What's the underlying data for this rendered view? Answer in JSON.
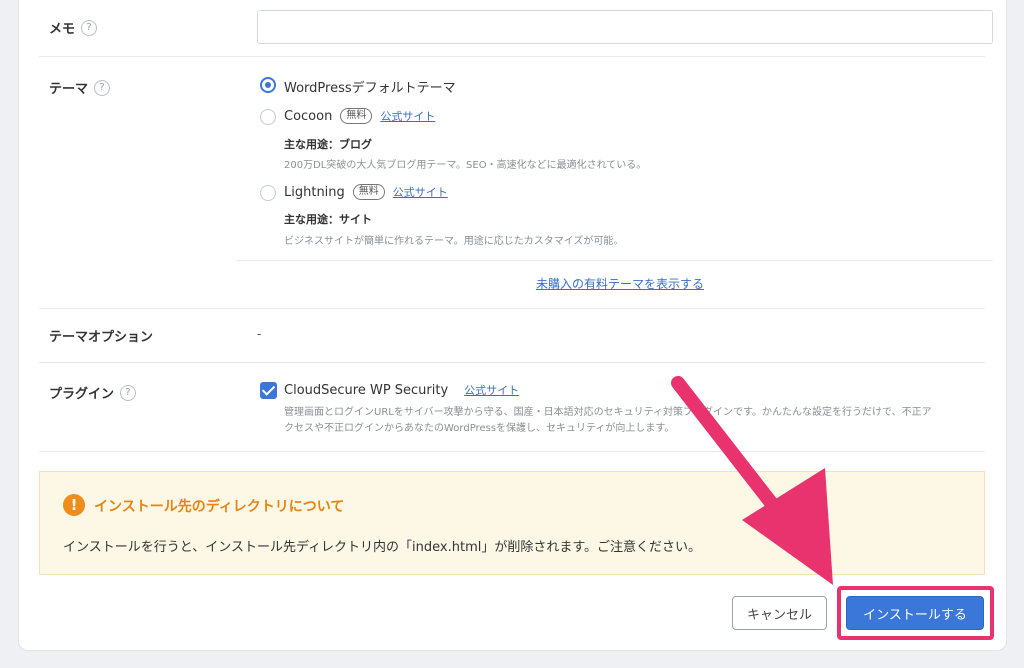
{
  "memo": {
    "label": "メモ",
    "help": "?",
    "value": ""
  },
  "theme": {
    "label": "テーマ",
    "help": "?",
    "options": [
      {
        "name": "WordPressデフォルトテーマ",
        "selected": true
      },
      {
        "name": "Cocoon",
        "badge": "無料",
        "link": "公式サイト",
        "use": "主な用途：ブログ",
        "desc": "200万DL突破の大人気ブログ用テーマ。SEO・高速化などに最適化されている。"
      },
      {
        "name": "Lightning",
        "badge": "無料",
        "link": "公式サイト",
        "use": "主な用途：サイト",
        "desc": "ビジネスサイトが簡単に作れるテーマ。用途に応じたカスタマイズが可能。"
      }
    ],
    "show_paid": "未購入の有料テーマを表示する"
  },
  "theme_option": {
    "label": "テーマオプション",
    "value": "-"
  },
  "plugin": {
    "label": "プラグイン",
    "help": "?",
    "name": "CloudSecure WP Security",
    "link": "公式サイト",
    "checked": true,
    "desc_line1": "管理画面とログインURLをサイバー攻撃から守る、国産・日本語対応のセキュリティ対策プラグインです。かんたんな設定を行うだけで、不正ア",
    "desc_line2": "クセスや不正ログインからあなたのWordPressを保護し、セキュリティが向上します。"
  },
  "notice": {
    "icon": "!",
    "title": "インストール先のディレクトリについて",
    "text": "インストールを行うと、インストール先ディレクトリ内の「index.html」が削除されます。ご注意ください。"
  },
  "buttons": {
    "cancel": "キャンセル",
    "install": "インストールする"
  },
  "colors": {
    "accent": "#3a77d8",
    "warning": "#e68413",
    "annotation": "#e8336e"
  }
}
